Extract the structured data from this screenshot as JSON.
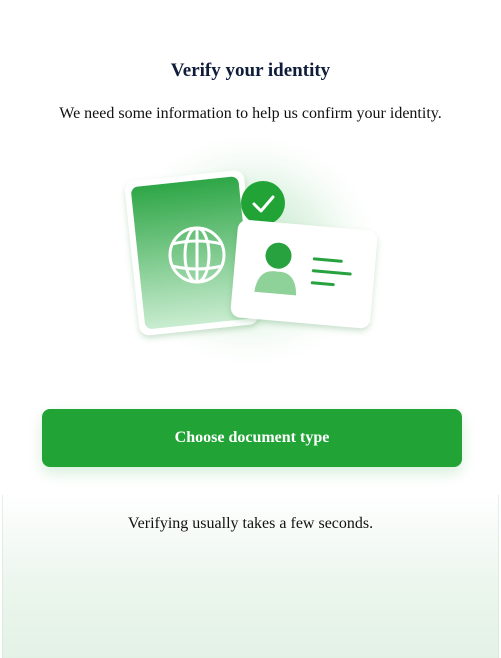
{
  "header": {
    "title": "Verify your identity",
    "subtitle": "We need some information to help us confirm your identity."
  },
  "illustration": {
    "icons": [
      "passport-icon",
      "globe-icon",
      "id-card-icon",
      "person-icon",
      "checkmark-icon"
    ]
  },
  "actions": {
    "choose_document_label": "Choose document type"
  },
  "footer": {
    "note": "Verifying usually takes a few seconds."
  },
  "colors": {
    "accent": "#21a336",
    "title": "#0f1d3a",
    "text": "#111111",
    "background": "#ffffff"
  }
}
